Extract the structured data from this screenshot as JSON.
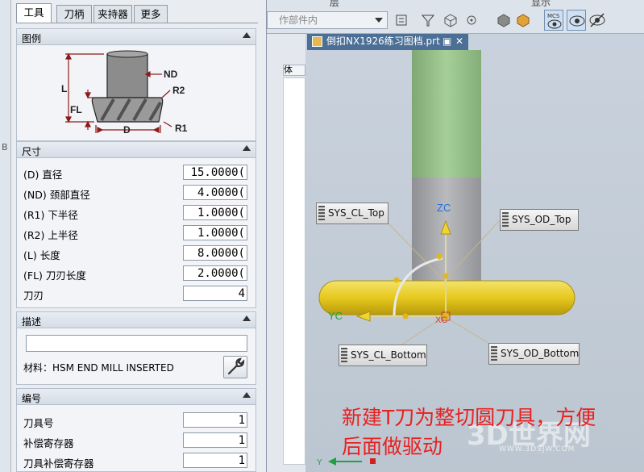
{
  "tabs": [
    "工具",
    "刀柄",
    "夹持器",
    "更多"
  ],
  "groups": {
    "legend": {
      "title": "图例",
      "diagram": {
        "nd": "ND",
        "r2": "R2",
        "l": "L",
        "fl": "FL",
        "d": "D",
        "r1": "R1"
      }
    },
    "dimensions": {
      "title": "尺寸",
      "rows": [
        {
          "label": "(D) 直径",
          "value": "15.0000("
        },
        {
          "label": "(ND) 颈部直径",
          "value": "4.0000("
        },
        {
          "label": "(R1) 下半径",
          "value": "1.0000("
        },
        {
          "label": "(R2) 上半径",
          "value": "1.0000("
        },
        {
          "label": "(L) 长度",
          "value": "8.0000("
        },
        {
          "label": "(FL) 刀刃长度",
          "value": "2.0000("
        },
        {
          "label": "刀刃",
          "value": "4"
        }
      ]
    },
    "description": {
      "title": "描述",
      "value": "",
      "material": "材料：HSM END MILL INSERTED"
    },
    "numbering": {
      "title": "编号",
      "rows": [
        {
          "label": "刀具号",
          "value": "1"
        },
        {
          "label": "补偿寄存器",
          "value": "1"
        },
        {
          "label": "刀具补偿寄存器",
          "value": "1"
        }
      ]
    }
  },
  "toolbar": {
    "layer_label": "层",
    "display_label": "显示",
    "combo_placeholder": "作部件内"
  },
  "midpanel": {
    "fragment": "体",
    "left_fragment": "B"
  },
  "viewport": {
    "document_tab": "倒扣NX1926练习图档.prt",
    "labels": [
      "SYS_CL_Top",
      "SYS_OD_Top",
      "SYS_CL_Bottom",
      "SYS_OD_Bottom"
    ],
    "axes": {
      "zc": "ZC",
      "yc": "YC",
      "xc": "XC",
      "y": "Y"
    },
    "note_line1": "新建T刀为整切圆刀具，方便",
    "note_line2": "后面做驱动",
    "watermark": "3D世界网",
    "watermark_url": "WWW.3DSJW.COM",
    "colors": {
      "neck": "#98c08a",
      "holder": "#a7a9ad",
      "disc": "#e3cc20",
      "note": "#e82020",
      "accent": "#4c6f95"
    }
  }
}
